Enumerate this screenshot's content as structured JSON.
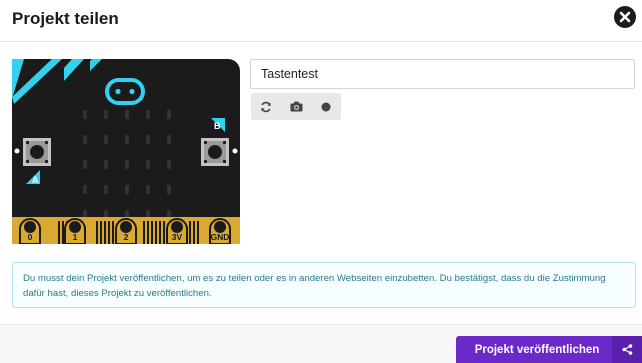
{
  "dialog": {
    "title": "Projekt teilen"
  },
  "project": {
    "name": "Tastentest"
  },
  "microbit": {
    "button_a": "A",
    "button_b": "B",
    "pins": [
      "0",
      "1",
      "2",
      "3V",
      "GND"
    ]
  },
  "toolbar": {
    "icons": [
      "refresh-icon",
      "camera-icon",
      "record-icon"
    ]
  },
  "notice": {
    "text": "Du musst dein Projekt veröffentlichen, um es zu teilen oder es in anderen Webseiten einzubetten. Du bestätigst, dass du die Zustimmung dafür hast, dieses Projekt zu veröffentlichen."
  },
  "footer": {
    "publish_label": "Projekt veröffentlichen"
  },
  "colors": {
    "accent": "#6b29c9",
    "board": "#1b1b1b",
    "led_logo": "#33d1f0",
    "pins": "#d9a932"
  }
}
